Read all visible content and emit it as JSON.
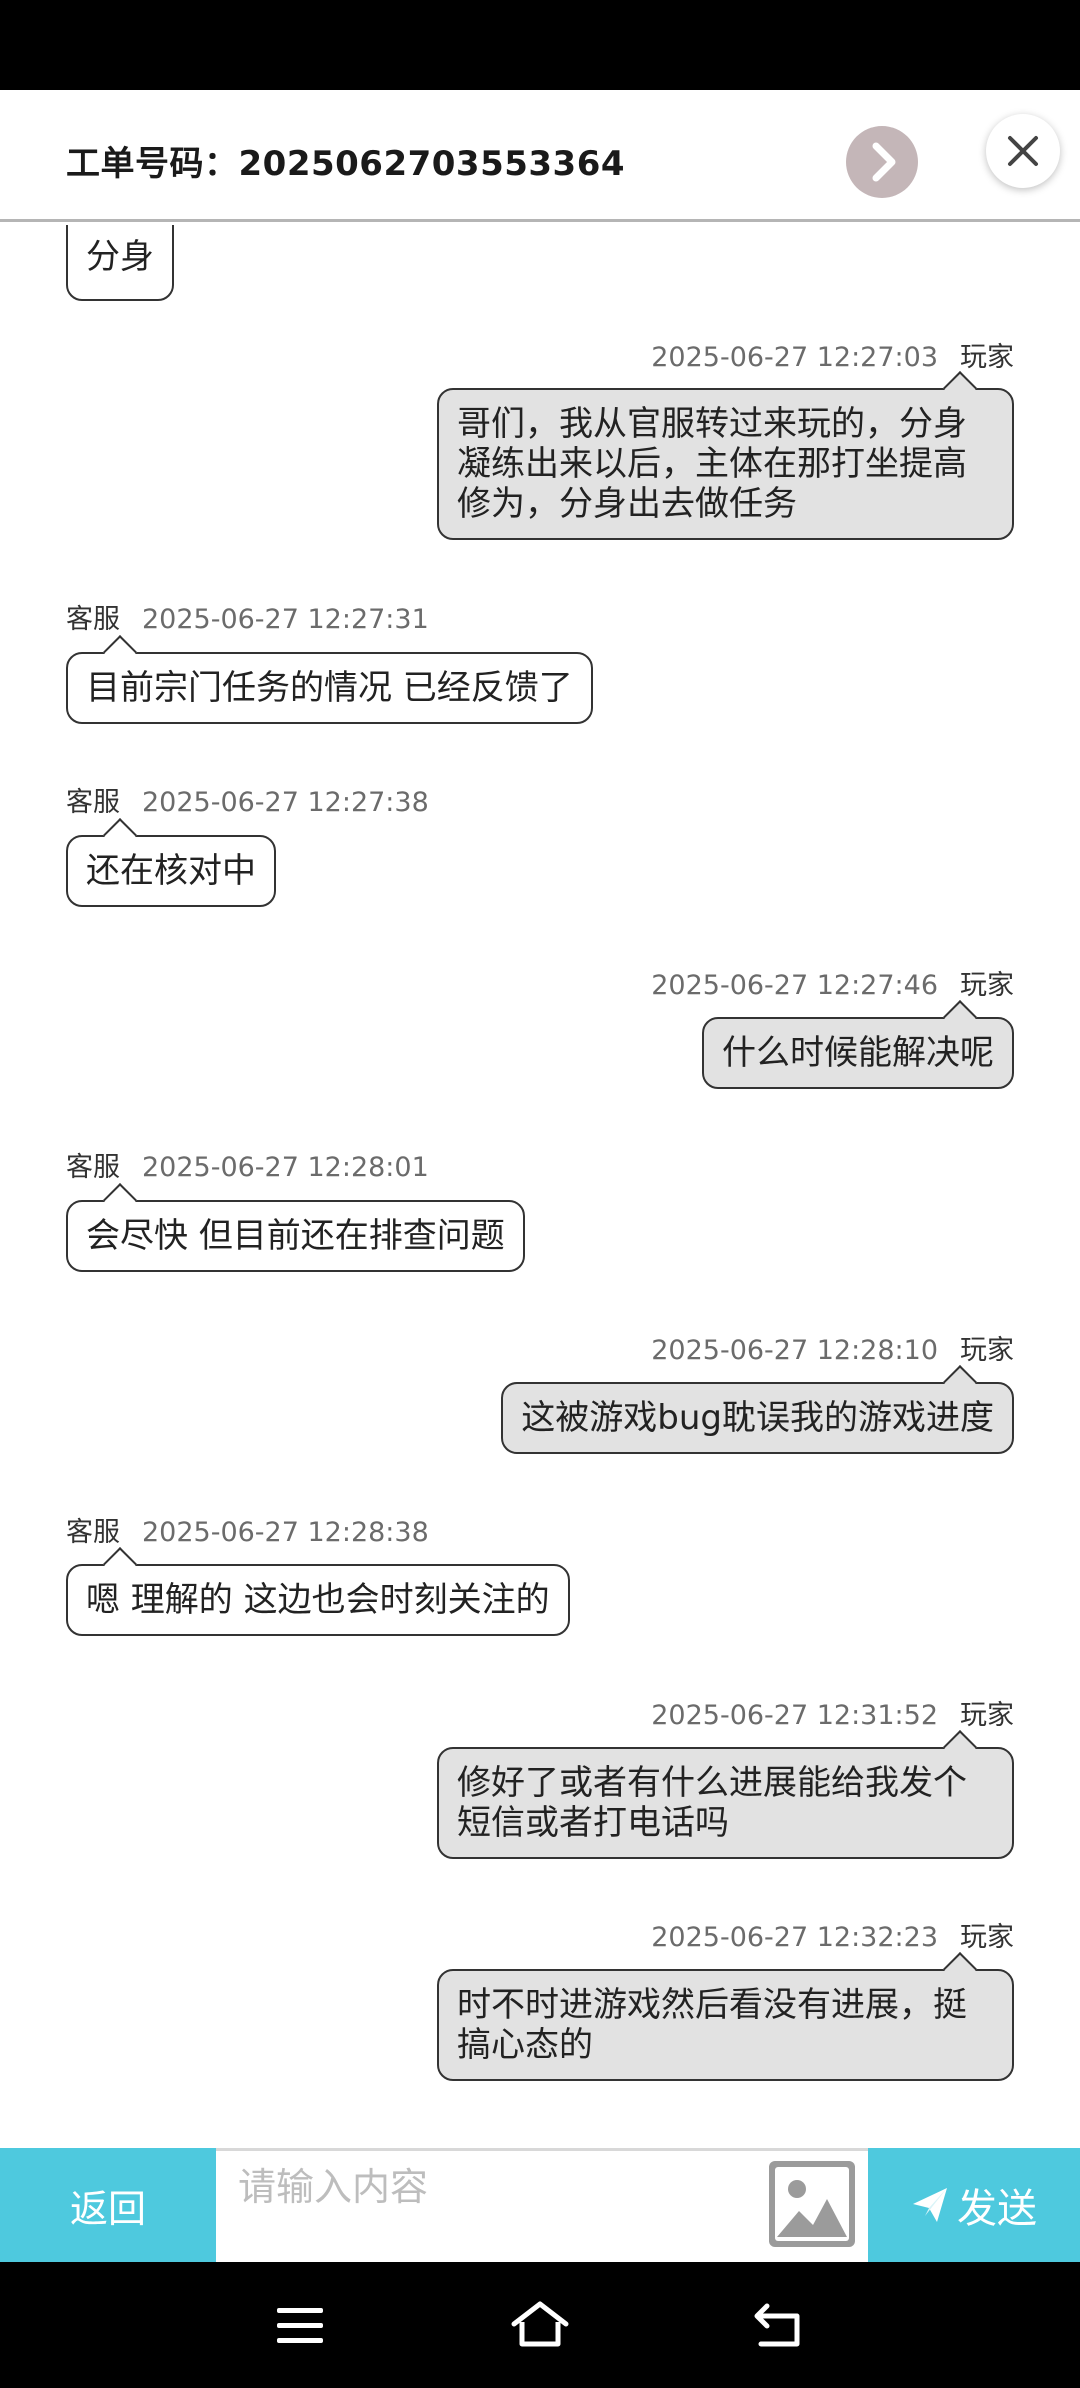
{
  "header": {
    "ticket_label": "工单号码：2025062703553364"
  },
  "icons": {
    "next": "chevron-right-icon",
    "close": "close-icon",
    "image": "image-icon",
    "send": "paper-plane-icon",
    "menu": "menu-icon",
    "home": "home-icon",
    "back": "back-icon"
  },
  "colors": {
    "accent": "#4ec9de",
    "player_bubble": "#e2e2e2",
    "cs_bubble": "#ffffff",
    "next_button": "#c4b6b8"
  },
  "messages": [
    {
      "role": "客服",
      "side": "left",
      "time": "",
      "text": "分身"
    },
    {
      "role": "玩家",
      "side": "right",
      "time": "2025-06-27 12:27:03",
      "text": "哥们，我从官服转过来玩的，分身凝练出来以后，主体在那打坐提高修为，分身出去做任务"
    },
    {
      "role": "客服",
      "side": "left",
      "time": "2025-06-27 12:27:31",
      "text": "目前宗门任务的情况 已经反馈了"
    },
    {
      "role": "客服",
      "side": "left",
      "time": "2025-06-27 12:27:38",
      "text": "还在核对中"
    },
    {
      "role": "玩家",
      "side": "right",
      "time": "2025-06-27 12:27:46",
      "text": "什么时候能解决呢"
    },
    {
      "role": "客服",
      "side": "left",
      "time": "2025-06-27 12:28:01",
      "text": "会尽快 但目前还在排查问题"
    },
    {
      "role": "玩家",
      "side": "right",
      "time": "2025-06-27 12:28:10",
      "text": "这被游戏bug耽误我的游戏进度"
    },
    {
      "role": "客服",
      "side": "left",
      "time": "2025-06-27 12:28:38",
      "text": "嗯 理解的 这边也会时刻关注的"
    },
    {
      "role": "玩家",
      "side": "right",
      "time": "2025-06-27 12:31:52",
      "text": "修好了或者有什么进展能给我发个短信或者打电话吗"
    },
    {
      "role": "玩家",
      "side": "right",
      "time": "2025-06-27 12:32:23",
      "text": "时不时进游戏然后看没有进展，挺搞心态的"
    }
  ],
  "footer": {
    "back_label": "返回",
    "input_placeholder": "请输入内容",
    "input_value": "",
    "send_label": "发送"
  }
}
